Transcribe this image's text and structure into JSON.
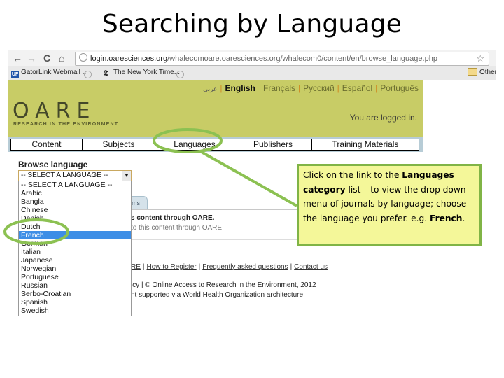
{
  "slide": {
    "title": "Searching by Language"
  },
  "browser": {
    "back_icon": "←",
    "forward_icon": "→",
    "reload_icon": "C",
    "home_icon": "⌂",
    "url_host": "login.oaresciences.org",
    "url_path": "/whalecomoare.oaresciences.org/whalecom0/content/en/browse_language.php",
    "star_icon": "☆",
    "bookmarks": [
      {
        "label": "GatorLink Webmail ..."
      },
      {
        "label": ""
      },
      {
        "label": "The New York Time..."
      },
      {
        "label": ""
      }
    ],
    "other_bookmarks": "Other"
  },
  "site": {
    "languages": {
      "arabic": "عربي",
      "english": "English",
      "french": "Françals",
      "russian": "Русский",
      "spanish": "Español",
      "portuguese": "Português"
    },
    "logo": "OARE",
    "tagline": "RESEARCH IN THE ENVIRONMENT",
    "logged_in": "You are logged in.",
    "nav": [
      {
        "label": "Content"
      },
      {
        "label": "Subjects"
      },
      {
        "label": "Languages"
      },
      {
        "label": "Publishers"
      },
      {
        "label": "Training Materials"
      }
    ]
  },
  "browse": {
    "title": "Browse language",
    "select_value": "-- SELECT A LANGUAGE --",
    "options": [
      "-- SELECT A LANGUAGE --",
      "Arabic",
      "Bangla",
      "Chinese",
      "Danish",
      "Dutch",
      "French",
      "German",
      "Italian",
      "Japanese",
      "Norwegian",
      "Portuguese",
      "Russian",
      "Serbo-Croatian",
      "Spanish",
      "Swedish"
    ],
    "selected_option": "French"
  },
  "content": {
    "tab_label": "ms",
    "line1": "s content through OARE.",
    "line2": "to this content through OARE.",
    "footer_links": [
      "RE",
      "How to Register",
      "Frequently asked questions",
      "Contact us"
    ],
    "footer_line2": "icy | © Online Access to Research in the Environment, 2012",
    "footer_line3": "nt supported via World Health Organization architecture"
  },
  "callout": {
    "part1": "Click on the link to the ",
    "bold1": "Languages category",
    "part2": " list – to view the drop down menu of journals by language; choose the language you prefer. e.g. ",
    "bold2": "French",
    "part3": "."
  },
  "colors": {
    "header_bg": "#c8cc66",
    "highlight_green": "#8cc152",
    "callout_bg": "#f4f799",
    "selected_option_bg": "#3d8ee6"
  }
}
